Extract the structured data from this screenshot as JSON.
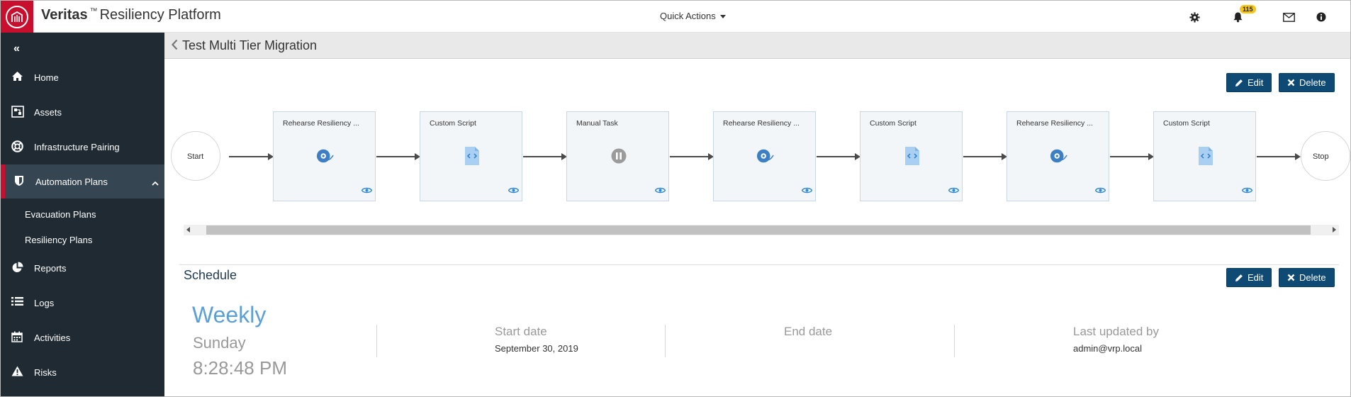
{
  "app": {
    "brand_bold": "Veritas",
    "brand_tm": "™",
    "brand_rest": "Resiliency Platform"
  },
  "topbar": {
    "quick_actions_label": "Quick Actions",
    "notification_count": "115",
    "icons": [
      "gear-icon",
      "bell-icon",
      "mail-icon",
      "info-icon"
    ]
  },
  "sidebar": {
    "collapse_glyph": "«",
    "items": [
      {
        "label": "Home",
        "icon": "home-icon"
      },
      {
        "label": "Assets",
        "icon": "assets-icon"
      },
      {
        "label": "Infrastructure Pairing",
        "icon": "lifebuoy-icon"
      },
      {
        "label": "Automation Plans",
        "icon": "shield-icon",
        "active": true
      },
      {
        "label": "Reports",
        "icon": "pie-chart-icon"
      },
      {
        "label": "Logs",
        "icon": "list-icon"
      },
      {
        "label": "Activities",
        "icon": "calendar-icon"
      },
      {
        "label": "Risks",
        "icon": "warning-icon"
      }
    ],
    "subitems": [
      {
        "label": "Evacuation Plans"
      },
      {
        "label": "Resiliency Plans"
      }
    ]
  },
  "page": {
    "title": "Test Multi Tier Migration",
    "edit_label": "Edit",
    "delete_label": "Delete"
  },
  "workflow": {
    "start_label": "Start",
    "stop_label": "Stop",
    "nodes": [
      {
        "title": "Rehearse Resiliency ...",
        "icon": "rehearse-icon"
      },
      {
        "title": "Custom Script",
        "icon": "script-file-icon"
      },
      {
        "title": "Manual Task",
        "icon": "pause-icon"
      },
      {
        "title": "Rehearse Resiliency ...",
        "icon": "rehearse-icon"
      },
      {
        "title": "Custom Script",
        "icon": "script-file-icon"
      },
      {
        "title": "Rehearse Resiliency ...",
        "icon": "rehearse-icon"
      },
      {
        "title": "Custom Script",
        "icon": "script-file-icon"
      }
    ]
  },
  "schedule": {
    "title": "Schedule",
    "frequency": "Weekly",
    "day": "Sunday",
    "time": "8:28:48 PM",
    "start_date_label": "Start date",
    "start_date_value": "September 30, 2019",
    "end_date_label": "End date",
    "last_updated_label": "Last updated by",
    "last_updated_value": "admin@vrp.local"
  },
  "colors": {
    "brand_red": "#c8102e",
    "sidebar_bg": "#1f2a33",
    "button_blue": "#0e4a73",
    "accent_blue": "#5b9fd6"
  }
}
